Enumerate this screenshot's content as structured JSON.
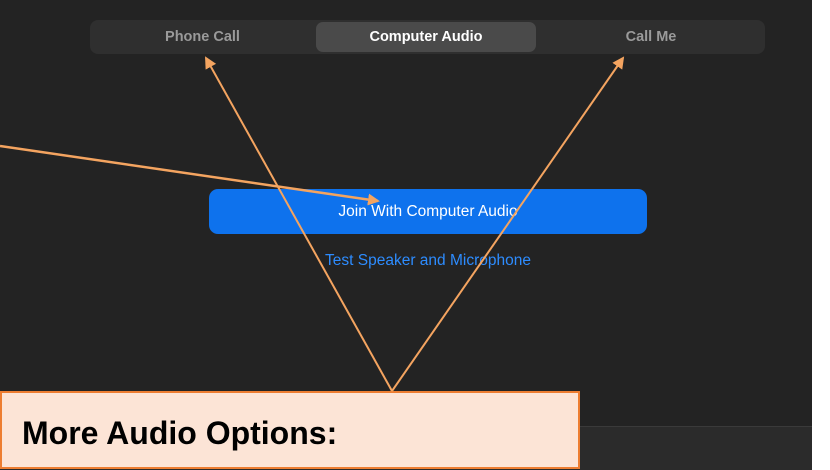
{
  "tabs": {
    "phone_call": "Phone Call",
    "computer_audio": "Computer Audio",
    "call_me": "Call Me"
  },
  "join_button_label": "Join With Computer Audio",
  "test_link_label": "Test Speaker and Microphone",
  "callout_title": "More Audio Options:",
  "colors": {
    "window_background": "#232323",
    "primary_blue": "#0e72ed",
    "link_blue": "#2d8cff",
    "annotation_orange": "#ed7d31",
    "callout_fill": "#fce4d6"
  }
}
